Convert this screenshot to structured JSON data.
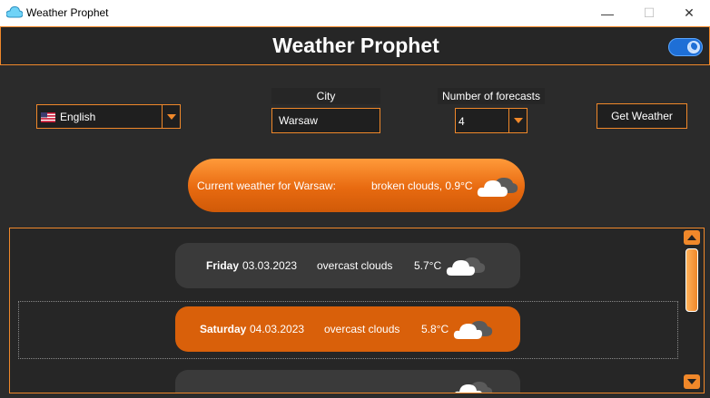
{
  "window": {
    "title": "Weather Prophet",
    "controls": {
      "minimize": "—",
      "maximize": "☐",
      "close": "✕"
    }
  },
  "header": {
    "title": "Weather Prophet",
    "theme_toggle_icon": "moon-icon"
  },
  "controls": {
    "language": {
      "value": "English",
      "flag_icon": "us-flag-icon"
    },
    "city": {
      "label": "City",
      "value": "Warsaw"
    },
    "forecasts": {
      "label": "Number of forecasts",
      "value": "4"
    },
    "get_weather_label": "Get Weather"
  },
  "current": {
    "label": "Current weather for Warsaw:",
    "description": "broken clouds, 0.9°C",
    "icon": "cloud-icon"
  },
  "forecasts": [
    {
      "day": "Friday",
      "date": "03.03.2023",
      "condition": "overcast clouds",
      "temp": "5.7°C",
      "icon": "cloud-icon"
    },
    {
      "day": "Saturday",
      "date": "04.03.2023",
      "condition": "overcast clouds",
      "temp": "5.8°C",
      "icon": "cloud-icon"
    },
    {
      "day": "",
      "date": "",
      "condition": "",
      "temp": "",
      "icon": "cloud-icon"
    }
  ],
  "colors": {
    "accent": "#f0882a",
    "background": "#2b2b2b",
    "card_dark": "#3a3a3a",
    "card_selected": "#d9600a",
    "toggle": "#1e6fd6"
  }
}
